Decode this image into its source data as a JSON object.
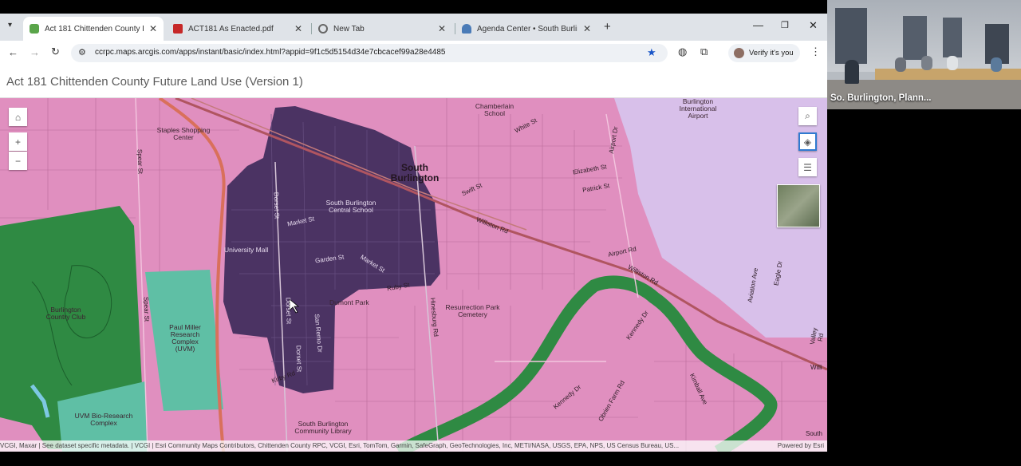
{
  "tabs": [
    {
      "title": "Act 181 Chittenden County Futu",
      "active": true
    },
    {
      "title": "ACT181 As Enacted.pdf",
      "active": false
    },
    {
      "title": "New Tab",
      "active": false
    },
    {
      "title": "Agenda Center • South Burlingt",
      "active": false
    }
  ],
  "toolbar": {
    "url": "ccrpc.maps.arcgis.com/apps/instant/basic/index.html?appid=9f1c5d5154d34e7cbcacef99a28e4485",
    "verify_label": "Verify it's you"
  },
  "app": {
    "title": "Act 181 Chittenden County Future Land Use (Version 1)"
  },
  "map": {
    "labels": {
      "south_burlington": "South Burlington",
      "staples": "Staples Shopping Center",
      "chamberlain": "Chamberlain School",
      "airport": "Burlington International Airport",
      "sb_central_school": "South Burlington Central School",
      "market_st": "Market St",
      "garden_st": "Garden St",
      "market_st2": "Market St",
      "university_mall": "University Mall",
      "williston_rd": "Williston Rd",
      "williston_rd2": "Williston Rd",
      "airport_rd": "Airport Rd",
      "elizabeth_st": "Elizabeth St",
      "patrick_st": "Patrick St",
      "dorset_st": "Dorset St",
      "dorset_st2": "Dorset St",
      "dorset_st3": "Dorset St",
      "san_remo": "San Remo Dr",
      "dumont_park": "Dumont Park",
      "resurrection": "Resurrection Park Cemetery",
      "burlington_cc": "Burlington Country Club",
      "paul_miller": "Paul Miller Research Complex (UVM)",
      "uvm_bio": "UVM Bio-Research Complex",
      "sb_library": "South Burlington Community Library",
      "spear_st": "Spear St",
      "spear_st2": "Spear St",
      "kennedy_dr": "Kennedy Dr",
      "kennedy_dr2": "Kennedy Dr",
      "obrien": "Obrien Farm Rd",
      "kimball": "Kimball Ave",
      "aviation": "Aviation Ave",
      "eagle": "Eagle Dr",
      "valley": "Valley Rd",
      "white_st": "White St",
      "swift_st": "Swift St",
      "hinesburg": "Hinesburg Rd",
      "ruby": "Ruby St",
      "airport_dr": "Airport Dr",
      "kirby": "Kirby Rd",
      "willi": "Willi",
      "south": "South"
    },
    "attribution": "VCGI, Maxar | See dataset specific metadata. | VCGI | Esri Community Maps Contributors, Chittenden County RPC, VCGI, Esri, TomTom, Garmin, SafeGraph, GeoTechnologies, Inc, METI/NASA, USGS, EPA, NPS, US Census Bureau, US...",
    "powered_by": "Powered by Esri",
    "colors": {
      "base": "#e08fbf",
      "downtown": "#4b3363",
      "green": "#2f8a43",
      "teal": "#5fbfa5",
      "airport": "#d8c0ea"
    }
  },
  "video": {
    "participant": "So. Burlington, Plann..."
  }
}
